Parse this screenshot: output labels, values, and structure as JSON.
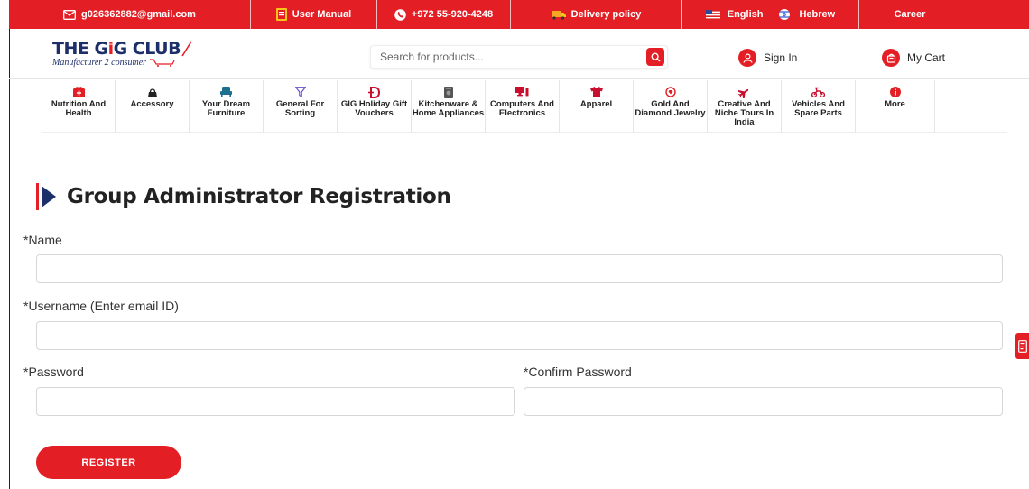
{
  "topbar": {
    "email": "g026362882@gmail.com",
    "manual": "User Manual",
    "phone": "+972 55-920-4248",
    "delivery": "Delivery policy",
    "lang_en": "English",
    "lang_he": "Hebrew",
    "career": "Career"
  },
  "header": {
    "logo_title_a": "THE G",
    "logo_title_b": "i",
    "logo_title_c": "G CLUB",
    "logo_sub": "Manufacturer 2 consumer",
    "search_placeholder": "Search for products...",
    "sign_in": "Sign In",
    "cart": "My Cart"
  },
  "categories": [
    {
      "label": "Nutrition And Health",
      "icon": "medkit-icon"
    },
    {
      "label": "Accessory",
      "icon": "bag-icon"
    },
    {
      "label": "Your Dream Furniture",
      "icon": "chair-icon"
    },
    {
      "label": "General For Sorting",
      "icon": "filter-icon"
    },
    {
      "label": "GIG Holiday Gift Vouchers",
      "icon": "gift-voucher-icon"
    },
    {
      "label": "Kitchenware & Home Appliances",
      "icon": "appliance-icon"
    },
    {
      "label": "Computers And Electronics",
      "icon": "computer-icon"
    },
    {
      "label": "Apparel",
      "icon": "shirt-icon"
    },
    {
      "label": "Gold And Diamond Jewelry",
      "icon": "ring-icon"
    },
    {
      "label": "Creative And Niche Tours In India",
      "icon": "plane-icon"
    },
    {
      "label": "Vehicles And Spare Parts",
      "icon": "scooter-icon"
    },
    {
      "label": "More",
      "icon": "info-icon"
    }
  ],
  "form": {
    "title": "Group Administrator Registration",
    "name_label": "*Name",
    "username_label": "*Username (Enter email ID)",
    "password_label": "*Password",
    "confirm_label": "*Confirm Password",
    "register": "REGISTER"
  },
  "colors": {
    "brand_red": "#e31e24",
    "brand_navy": "#1c2f6b"
  }
}
